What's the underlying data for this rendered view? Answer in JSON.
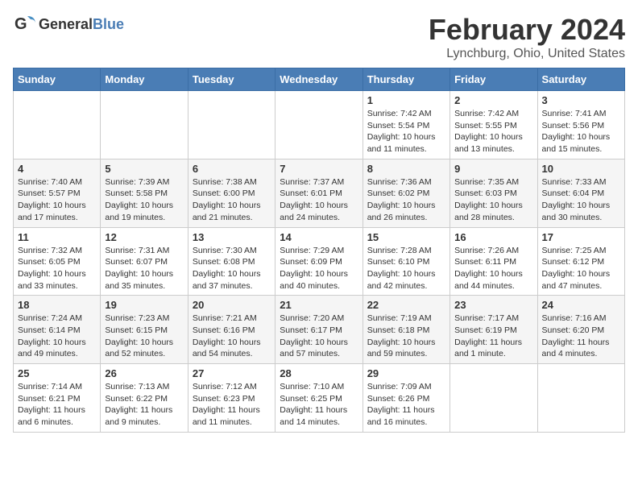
{
  "header": {
    "logo_general": "General",
    "logo_blue": "Blue",
    "month_year": "February 2024",
    "location": "Lynchburg, Ohio, United States"
  },
  "calendar": {
    "days_of_week": [
      "Sunday",
      "Monday",
      "Tuesday",
      "Wednesday",
      "Thursday",
      "Friday",
      "Saturday"
    ],
    "weeks": [
      [
        {
          "day": "",
          "info": ""
        },
        {
          "day": "",
          "info": ""
        },
        {
          "day": "",
          "info": ""
        },
        {
          "day": "",
          "info": ""
        },
        {
          "day": "1",
          "info": "Sunrise: 7:42 AM\nSunset: 5:54 PM\nDaylight: 10 hours\nand 11 minutes."
        },
        {
          "day": "2",
          "info": "Sunrise: 7:42 AM\nSunset: 5:55 PM\nDaylight: 10 hours\nand 13 minutes."
        },
        {
          "day": "3",
          "info": "Sunrise: 7:41 AM\nSunset: 5:56 PM\nDaylight: 10 hours\nand 15 minutes."
        }
      ],
      [
        {
          "day": "4",
          "info": "Sunrise: 7:40 AM\nSunset: 5:57 PM\nDaylight: 10 hours\nand 17 minutes."
        },
        {
          "day": "5",
          "info": "Sunrise: 7:39 AM\nSunset: 5:58 PM\nDaylight: 10 hours\nand 19 minutes."
        },
        {
          "day": "6",
          "info": "Sunrise: 7:38 AM\nSunset: 6:00 PM\nDaylight: 10 hours\nand 21 minutes."
        },
        {
          "day": "7",
          "info": "Sunrise: 7:37 AM\nSunset: 6:01 PM\nDaylight: 10 hours\nand 24 minutes."
        },
        {
          "day": "8",
          "info": "Sunrise: 7:36 AM\nSunset: 6:02 PM\nDaylight: 10 hours\nand 26 minutes."
        },
        {
          "day": "9",
          "info": "Sunrise: 7:35 AM\nSunset: 6:03 PM\nDaylight: 10 hours\nand 28 minutes."
        },
        {
          "day": "10",
          "info": "Sunrise: 7:33 AM\nSunset: 6:04 PM\nDaylight: 10 hours\nand 30 minutes."
        }
      ],
      [
        {
          "day": "11",
          "info": "Sunrise: 7:32 AM\nSunset: 6:05 PM\nDaylight: 10 hours\nand 33 minutes."
        },
        {
          "day": "12",
          "info": "Sunrise: 7:31 AM\nSunset: 6:07 PM\nDaylight: 10 hours\nand 35 minutes."
        },
        {
          "day": "13",
          "info": "Sunrise: 7:30 AM\nSunset: 6:08 PM\nDaylight: 10 hours\nand 37 minutes."
        },
        {
          "day": "14",
          "info": "Sunrise: 7:29 AM\nSunset: 6:09 PM\nDaylight: 10 hours\nand 40 minutes."
        },
        {
          "day": "15",
          "info": "Sunrise: 7:28 AM\nSunset: 6:10 PM\nDaylight: 10 hours\nand 42 minutes."
        },
        {
          "day": "16",
          "info": "Sunrise: 7:26 AM\nSunset: 6:11 PM\nDaylight: 10 hours\nand 44 minutes."
        },
        {
          "day": "17",
          "info": "Sunrise: 7:25 AM\nSunset: 6:12 PM\nDaylight: 10 hours\nand 47 minutes."
        }
      ],
      [
        {
          "day": "18",
          "info": "Sunrise: 7:24 AM\nSunset: 6:14 PM\nDaylight: 10 hours\nand 49 minutes."
        },
        {
          "day": "19",
          "info": "Sunrise: 7:23 AM\nSunset: 6:15 PM\nDaylight: 10 hours\nand 52 minutes."
        },
        {
          "day": "20",
          "info": "Sunrise: 7:21 AM\nSunset: 6:16 PM\nDaylight: 10 hours\nand 54 minutes."
        },
        {
          "day": "21",
          "info": "Sunrise: 7:20 AM\nSunset: 6:17 PM\nDaylight: 10 hours\nand 57 minutes."
        },
        {
          "day": "22",
          "info": "Sunrise: 7:19 AM\nSunset: 6:18 PM\nDaylight: 10 hours\nand 59 minutes."
        },
        {
          "day": "23",
          "info": "Sunrise: 7:17 AM\nSunset: 6:19 PM\nDaylight: 11 hours\nand 1 minute."
        },
        {
          "day": "24",
          "info": "Sunrise: 7:16 AM\nSunset: 6:20 PM\nDaylight: 11 hours\nand 4 minutes."
        }
      ],
      [
        {
          "day": "25",
          "info": "Sunrise: 7:14 AM\nSunset: 6:21 PM\nDaylight: 11 hours\nand 6 minutes."
        },
        {
          "day": "26",
          "info": "Sunrise: 7:13 AM\nSunset: 6:22 PM\nDaylight: 11 hours\nand 9 minutes."
        },
        {
          "day": "27",
          "info": "Sunrise: 7:12 AM\nSunset: 6:23 PM\nDaylight: 11 hours\nand 11 minutes."
        },
        {
          "day": "28",
          "info": "Sunrise: 7:10 AM\nSunset: 6:25 PM\nDaylight: 11 hours\nand 14 minutes."
        },
        {
          "day": "29",
          "info": "Sunrise: 7:09 AM\nSunset: 6:26 PM\nDaylight: 11 hours\nand 16 minutes."
        },
        {
          "day": "",
          "info": ""
        },
        {
          "day": "",
          "info": ""
        }
      ]
    ]
  }
}
